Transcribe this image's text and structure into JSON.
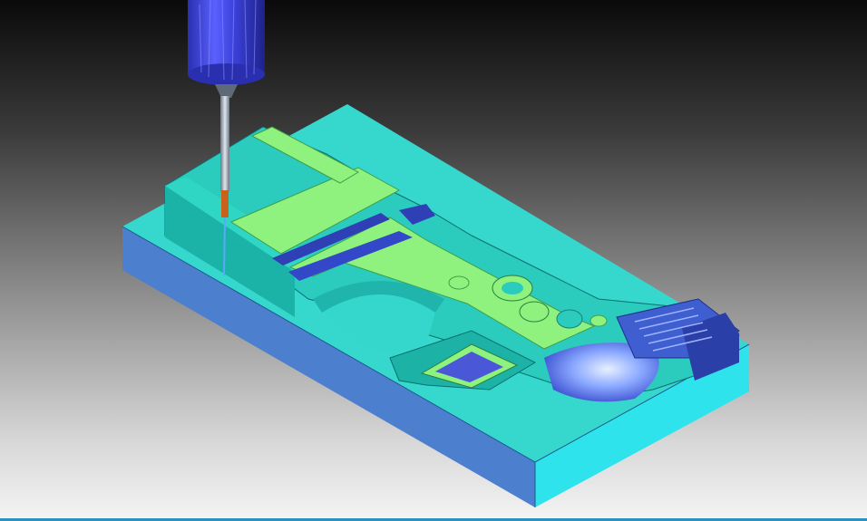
{
  "viewport": {
    "view": "isometric",
    "background": "gradient-black-to-white"
  },
  "model": {
    "stock_color": "#4f82cf",
    "stock_top_color": "#35d6cc",
    "stock_front_color": "#31e8ef",
    "wall_color": "#1fc6b9",
    "floor_color": "#8ff27f",
    "pocket_color": "#2f3fb5"
  },
  "tool": {
    "holder_color": "#3f45d8",
    "shank_color": "#a9b6c2",
    "flute_color": "#c8621c",
    "path_color": "#5aa8ff"
  }
}
